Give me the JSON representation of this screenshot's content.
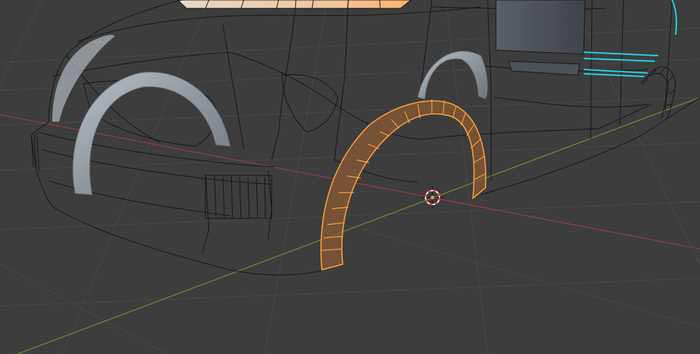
{
  "viewport": {
    "view": "3d-viewport",
    "mode": "edit-mode",
    "shading": "wireframe-xray"
  },
  "colors": {
    "background": "#3d3d3d",
    "grid_line": "#4a4a4a",
    "x_axis": "#9a3a46",
    "y_axis": "#6c8f2c",
    "wire_edge": "#141414",
    "selected_face": "#8a5a34",
    "selected_edge": "#ffa33a",
    "active_edges": "#22d8e8",
    "solid_surface": "#9aa2aa",
    "cursor_red": "#ff4040",
    "cursor_white": "#ffffff"
  },
  "icons": {
    "cursor": "3d-cursor-icon",
    "origin": "object-origin-icon"
  },
  "objects": [
    {
      "name": "car-body",
      "state": "unselected-wireframe"
    },
    {
      "name": "front-wheel-arch",
      "state": "solid-grey"
    },
    {
      "name": "rear-wheel-arch",
      "state": "selected-edit"
    },
    {
      "name": "rear-side-trim",
      "state": "active-edges"
    }
  ]
}
